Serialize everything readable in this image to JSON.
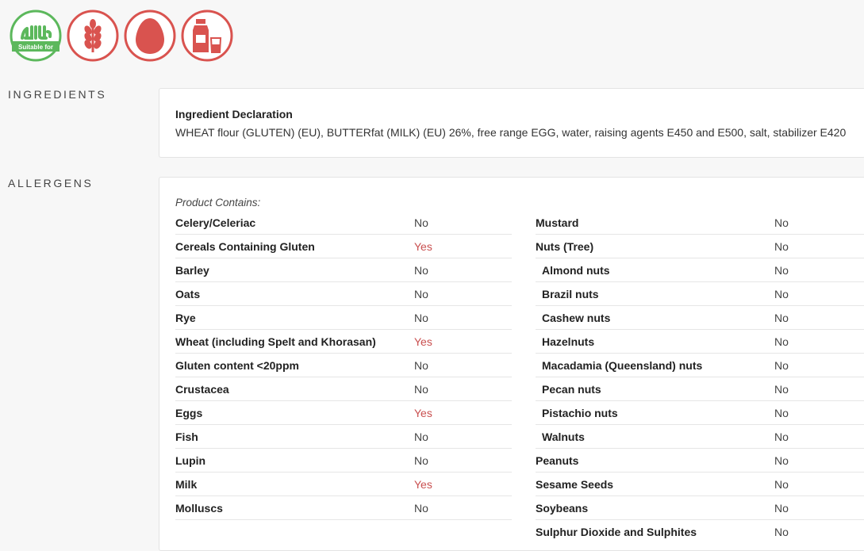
{
  "badges": {
    "halal_text": "Suitable for",
    "colors": {
      "green": "#5cb85c",
      "red": "#d9534f"
    },
    "icons": [
      "halal-icon",
      "gluten-wheat-icon",
      "egg-icon",
      "milk-icon"
    ]
  },
  "ingredients": {
    "section_label": "INGREDIENTS",
    "title": "Ingredient Declaration",
    "text": "WHEAT flour (GLUTEN) (EU), BUTTERfat (MILK) (EU) 26%, free range EGG, water, raising agents E450 and E500, salt, stabilizer E420"
  },
  "allergens": {
    "section_label": "ALLERGENS",
    "contains_label": "Product Contains:",
    "left": [
      {
        "name": "Celery/Celeriac",
        "value": "No"
      },
      {
        "name": "Cereals Containing Gluten",
        "value": "Yes"
      },
      {
        "name": "Barley",
        "value": "No"
      },
      {
        "name": "Oats",
        "value": "No"
      },
      {
        "name": "Rye",
        "value": "No"
      },
      {
        "name": "Wheat (including Spelt and Khorasan)",
        "value": "Yes"
      },
      {
        "name": "Gluten content <20ppm",
        "value": "No"
      },
      {
        "name": "Crustacea",
        "value": "No"
      },
      {
        "name": "Eggs",
        "value": "Yes"
      },
      {
        "name": "Fish",
        "value": "No"
      },
      {
        "name": "Lupin",
        "value": "No"
      },
      {
        "name": "Milk",
        "value": "Yes"
      },
      {
        "name": "Molluscs",
        "value": "No"
      }
    ],
    "right": [
      {
        "name": "Mustard",
        "value": "No"
      },
      {
        "name": "Nuts (Tree)",
        "value": "No"
      },
      {
        "name": "Almond nuts",
        "value": "No"
      },
      {
        "name": "Brazil nuts",
        "value": "No"
      },
      {
        "name": "Cashew nuts",
        "value": "No"
      },
      {
        "name": "Hazelnuts",
        "value": "No"
      },
      {
        "name": "Macadamia (Queensland) nuts",
        "value": "No"
      },
      {
        "name": "Pecan nuts",
        "value": "No"
      },
      {
        "name": "Pistachio nuts",
        "value": "No"
      },
      {
        "name": "Walnuts",
        "value": "No"
      },
      {
        "name": "Peanuts",
        "value": "No"
      },
      {
        "name": "Sesame Seeds",
        "value": "No"
      },
      {
        "name": "Soybeans",
        "value": "No"
      },
      {
        "name": "Sulphur Dioxide and Sulphites",
        "value": "No"
      }
    ]
  }
}
